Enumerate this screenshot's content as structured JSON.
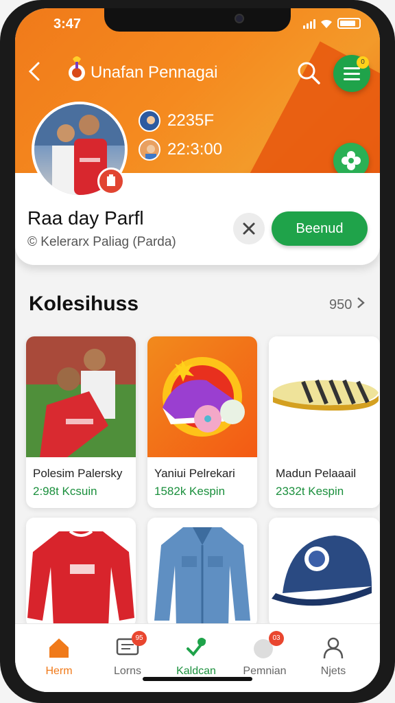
{
  "status_bar": {
    "time": "3:47"
  },
  "header": {
    "title": "Unafan Pennagai"
  },
  "menu": {
    "badge": "0"
  },
  "stats": [
    {
      "value": "2235F"
    },
    {
      "value": "22:3:00"
    }
  ],
  "profile": {
    "name": "Raa day Parfl",
    "subtitle": "© Kelerarx Paliag (Parda)",
    "follow_label": "Beenud"
  },
  "section": {
    "title": "Kolesihuss",
    "count": "950"
  },
  "products": [
    {
      "title": "Polesim Palersky",
      "price": "2:98t Kcsuin"
    },
    {
      "title": "Yaniui Pelrekari",
      "price": "1582k Kespin"
    },
    {
      "title": "Madun Pelaaail",
      "price": "2332t Kespin"
    }
  ],
  "bottom_nav": [
    {
      "label": "Herm",
      "icon": "home-icon",
      "badge": "",
      "active": true
    },
    {
      "label": "Lorns",
      "icon": "monitor-icon",
      "badge": "95",
      "active": false
    },
    {
      "label": "Kaldcan",
      "icon": "wrench-icon",
      "badge": "",
      "active": false
    },
    {
      "label": "Pemnian",
      "icon": "ball-icon",
      "badge": "03",
      "active": false
    },
    {
      "label": "Njets",
      "icon": "user-icon",
      "badge": "",
      "active": false
    }
  ],
  "colors": {
    "brand_orange": "#f07a1a",
    "accent_green": "#1fa34a",
    "badge_red": "#e9462f"
  }
}
